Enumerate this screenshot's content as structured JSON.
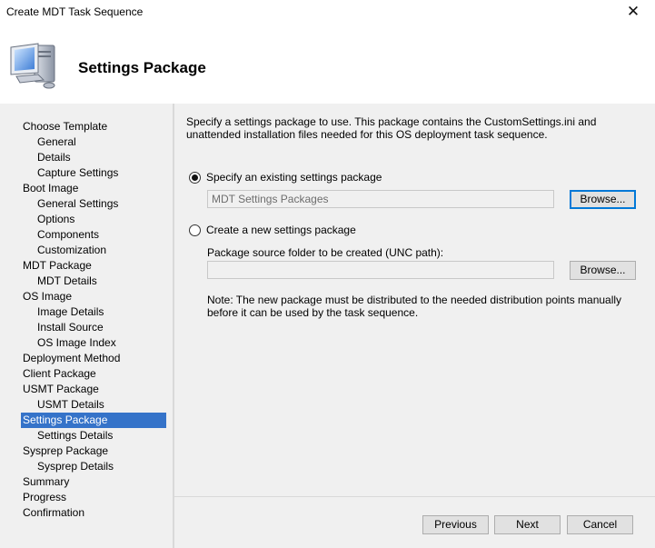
{
  "window": {
    "title": "Create MDT Task Sequence",
    "close_glyph": "✕"
  },
  "banner": {
    "heading": "Settings Package",
    "icon": "computer-wizard-icon"
  },
  "nav": {
    "items": [
      {
        "label": "Choose Template",
        "level": 0
      },
      {
        "label": "General",
        "level": 1
      },
      {
        "label": "Details",
        "level": 1
      },
      {
        "label": "Capture Settings",
        "level": 1
      },
      {
        "label": "Boot Image",
        "level": 0
      },
      {
        "label": "General Settings",
        "level": 1
      },
      {
        "label": "Options",
        "level": 1
      },
      {
        "label": "Components",
        "level": 1
      },
      {
        "label": "Customization",
        "level": 1
      },
      {
        "label": "MDT Package",
        "level": 0
      },
      {
        "label": "MDT Details",
        "level": 1
      },
      {
        "label": "OS Image",
        "level": 0
      },
      {
        "label": "Image Details",
        "level": 1
      },
      {
        "label": "Install Source",
        "level": 1
      },
      {
        "label": "OS Image Index",
        "level": 1
      },
      {
        "label": "Deployment Method",
        "level": 0
      },
      {
        "label": "Client Package",
        "level": 0
      },
      {
        "label": "USMT Package",
        "level": 0
      },
      {
        "label": "USMT Details",
        "level": 1
      },
      {
        "label": "Settings Package",
        "level": 0,
        "selected": true
      },
      {
        "label": "Settings Details",
        "level": 1
      },
      {
        "label": "Sysprep Package",
        "level": 0
      },
      {
        "label": "Sysprep Details",
        "level": 1
      },
      {
        "label": "Summary",
        "level": 0
      },
      {
        "label": "Progress",
        "level": 0
      },
      {
        "label": "Confirmation",
        "level": 0
      }
    ],
    "selected_color": "#3573c9"
  },
  "main": {
    "intro": "Specify a settings package to use.  This package contains the CustomSettings.ini and unattended installation files needed for this OS deployment task sequence.",
    "option_existing": {
      "label": "Specify an existing settings package",
      "checked": true,
      "value": "MDT Settings Packages",
      "browse_label": "Browse..."
    },
    "option_new": {
      "label": "Create a new settings package",
      "checked": false,
      "field_label": "Package source folder to be created (UNC path):",
      "value": "",
      "browse_label": "Browse..."
    },
    "note": "Note: The new package must be distributed to the needed distribution points manually before it can be used by the task sequence."
  },
  "footer": {
    "previous_label": "Previous",
    "next_label": "Next",
    "cancel_label": "Cancel"
  }
}
